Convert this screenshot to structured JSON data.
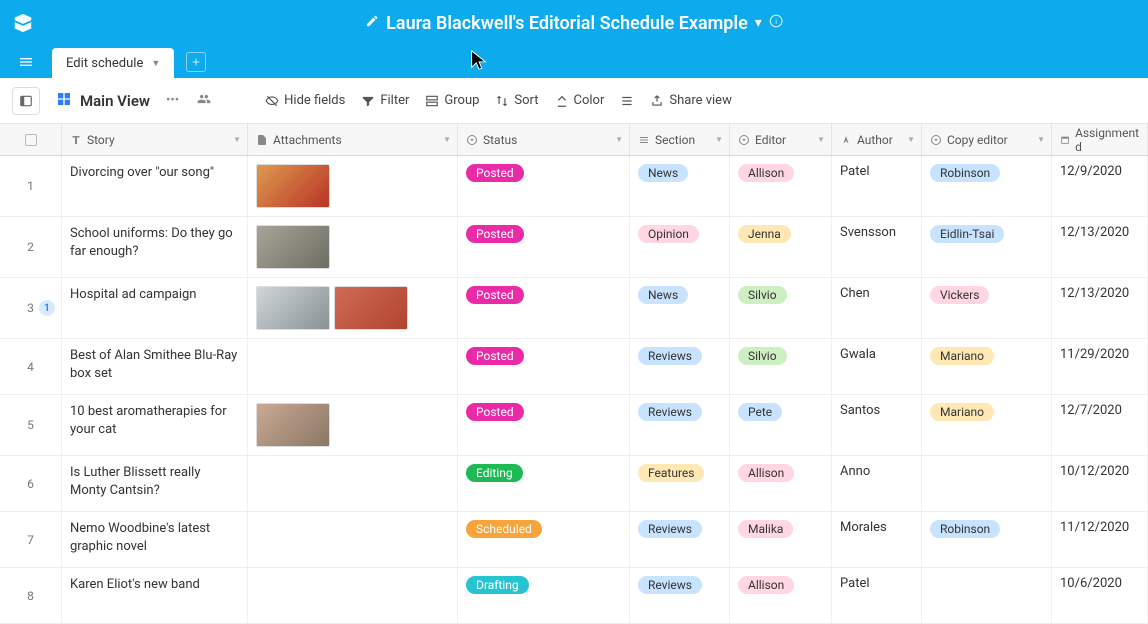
{
  "title": "Laura Blackwell's Editorial Schedule Example",
  "tab_label": "Edit schedule",
  "main_view_label": "Main View",
  "toolbar": {
    "hide_fields": "Hide fields",
    "filter": "Filter",
    "group": "Group",
    "sort": "Sort",
    "color": "Color",
    "share": "Share view"
  },
  "columns": {
    "story": "Story",
    "attachments": "Attachments",
    "status": "Status",
    "section": "Section",
    "editor": "Editor",
    "author": "Author",
    "copy_editor": "Copy editor",
    "assignment": "Assignment d"
  },
  "rows": [
    {
      "idx": "1",
      "story": "Divorcing over \"our song\"",
      "thumbs": [
        "r1"
      ],
      "status": "Posted",
      "status_cls": "pill-posted",
      "section": "News",
      "section_cls": "pill-news",
      "editor": "Allison",
      "editor_cls": "pill-allison",
      "author": "Patel",
      "copy": "Robinson",
      "copy_cls": "pill-robinson",
      "date": "12/9/2020",
      "count": null
    },
    {
      "idx": "2",
      "story": "School uniforms: Do they go far enough?",
      "thumbs": [
        "r2"
      ],
      "status": "Posted",
      "status_cls": "pill-posted",
      "section": "Opinion",
      "section_cls": "pill-opinion",
      "editor": "Jenna",
      "editor_cls": "pill-jenna",
      "author": "Svensson",
      "copy": "Eidlin-Tsai",
      "copy_cls": "pill-eidlin",
      "date": "12/13/2020",
      "count": null
    },
    {
      "idx": "3",
      "story": "Hospital ad campaign",
      "thumbs": [
        "r3a",
        "r3b"
      ],
      "status": "Posted",
      "status_cls": "pill-posted",
      "section": "News",
      "section_cls": "pill-news",
      "editor": "Silvio",
      "editor_cls": "pill-silvio",
      "author": "Chen",
      "copy": "Vickers",
      "copy_cls": "pill-vickers",
      "date": "12/13/2020",
      "count": "1"
    },
    {
      "idx": "4",
      "story": "Best of Alan Smithee Blu-Ray box set",
      "thumbs": [],
      "status": "Posted",
      "status_cls": "pill-posted",
      "section": "Reviews",
      "section_cls": "pill-reviews",
      "editor": "Silvio",
      "editor_cls": "pill-silvio",
      "author": "Gwala",
      "copy": "Mariano",
      "copy_cls": "pill-mariano",
      "date": "11/29/2020",
      "count": null
    },
    {
      "idx": "5",
      "story": "10 best aromatherapies for your cat",
      "thumbs": [
        "r5"
      ],
      "status": "Posted",
      "status_cls": "pill-posted",
      "section": "Reviews",
      "section_cls": "pill-reviews",
      "editor": "Pete",
      "editor_cls": "pill-pete",
      "author": "Santos",
      "copy": "Mariano",
      "copy_cls": "pill-mariano",
      "date": "12/7/2020",
      "count": null
    },
    {
      "idx": "6",
      "story": "Is Luther Blissett really Monty Cantsin?",
      "thumbs": [],
      "status": "Editing",
      "status_cls": "pill-editing",
      "section": "Features",
      "section_cls": "pill-features",
      "editor": "Allison",
      "editor_cls": "pill-allison",
      "author": "Anno",
      "copy": "",
      "copy_cls": "",
      "date": "10/12/2020",
      "count": null
    },
    {
      "idx": "7",
      "story": "Nemo Woodbine's latest graphic novel",
      "thumbs": [],
      "status": "Scheduled",
      "status_cls": "pill-scheduled",
      "section": "Reviews",
      "section_cls": "pill-reviews",
      "editor": "Malika",
      "editor_cls": "pill-malika",
      "author": "Morales",
      "copy": "Robinson",
      "copy_cls": "pill-robinson",
      "date": "11/12/2020",
      "count": null
    },
    {
      "idx": "8",
      "story": "Karen Eliot's new band",
      "thumbs": [],
      "status": "Drafting",
      "status_cls": "pill-drafting",
      "section": "Reviews",
      "section_cls": "pill-reviews",
      "editor": "Allison",
      "editor_cls": "pill-allison",
      "author": "Patel",
      "copy": "",
      "copy_cls": "",
      "date": "10/6/2020",
      "count": null
    }
  ]
}
